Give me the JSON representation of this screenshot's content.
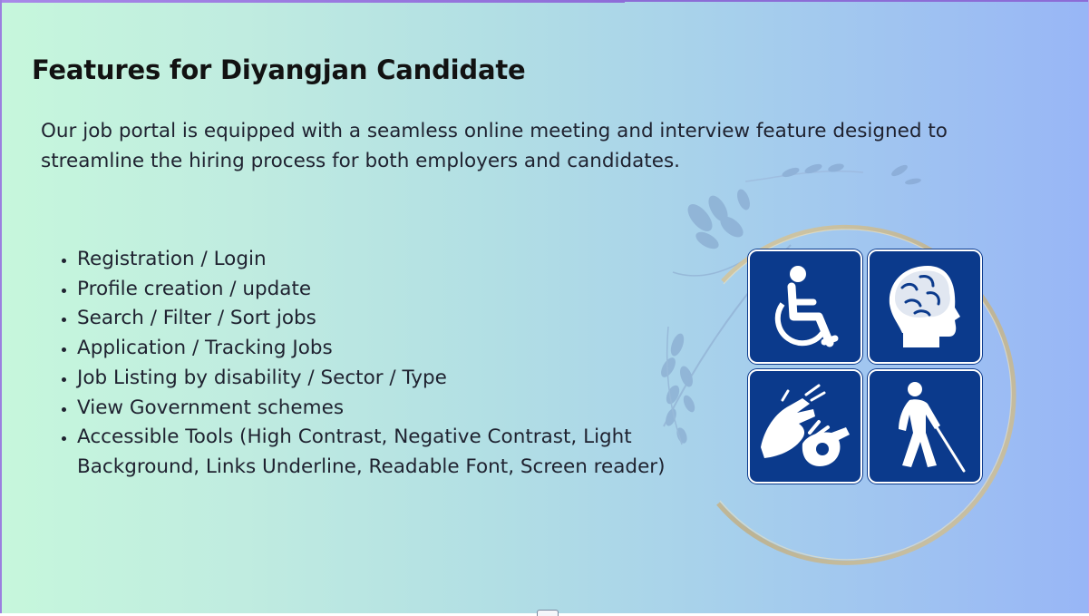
{
  "slide": {
    "title": "Features for Diyangjan Candidate",
    "intro": "Our job portal is equipped with a seamless online meeting and interview feature designed to streamline the hiring process for both employers and candidates.",
    "features": [
      "Registration / Login",
      "Profile creation / update",
      "Search / Filter / Sort jobs",
      "Application / Tracking Jobs",
      "Job Listing by disability / Sector / Type",
      "View Government schemes",
      "Accessible Tools (High Contrast, Negative Contrast, Light Background, Links Underline, Readable Font, Screen reader)"
    ],
    "icons": [
      "wheelchair-icon",
      "brain-head-icon",
      "sign-language-icon",
      "blind-person-cane-icon"
    ]
  },
  "colors": {
    "tile_blue": "#0b3a8c",
    "ring_gold": "#cbbd93",
    "gradient_left": "#c6f7dc",
    "gradient_right": "#98b6f6"
  }
}
